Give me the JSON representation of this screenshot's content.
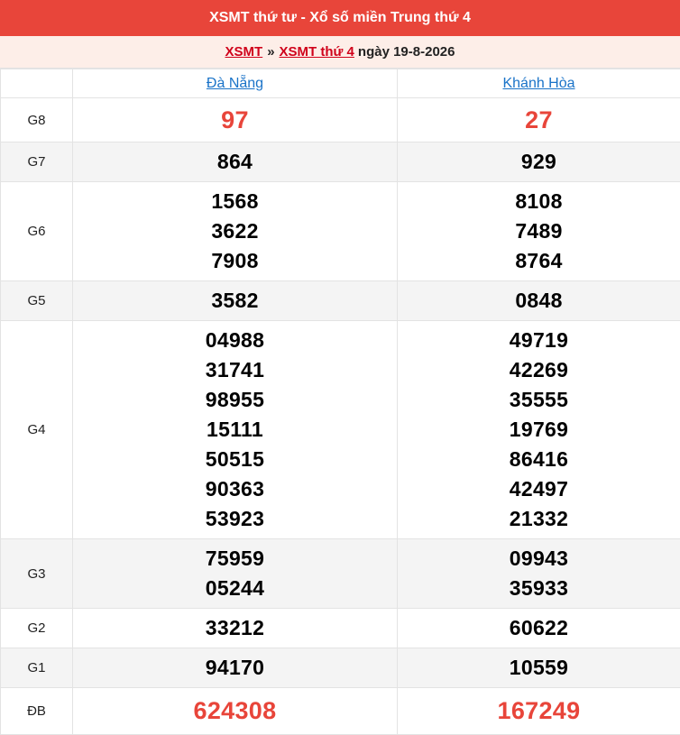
{
  "header": {
    "title": "XSMT thứ tư - Xổ số miền Trung thứ 4"
  },
  "breadcrumb": {
    "link1": "XSMT",
    "separator": "»",
    "link2": "XSMT thứ 4",
    "date": "ngày 19-8-2026"
  },
  "provinces": [
    "Đà Nẵng",
    "Khánh Hòa"
  ],
  "prizes": [
    {
      "label": "G8",
      "da_nang": [
        "97"
      ],
      "khanh_hoa": [
        "27"
      ]
    },
    {
      "label": "G7",
      "da_nang": [
        "864"
      ],
      "khanh_hoa": [
        "929"
      ]
    },
    {
      "label": "G6",
      "da_nang": [
        "1568",
        "3622",
        "7908"
      ],
      "khanh_hoa": [
        "8108",
        "7489",
        "8764"
      ]
    },
    {
      "label": "G5",
      "da_nang": [
        "3582"
      ],
      "khanh_hoa": [
        "0848"
      ]
    },
    {
      "label": "G4",
      "da_nang": [
        "04988",
        "31741",
        "98955",
        "15111",
        "50515",
        "90363",
        "53923"
      ],
      "khanh_hoa": [
        "49719",
        "42269",
        "35555",
        "19769",
        "86416",
        "42497",
        "21332"
      ]
    },
    {
      "label": "G3",
      "da_nang": [
        "75959",
        "05244"
      ],
      "khanh_hoa": [
        "09943",
        "35933"
      ]
    },
    {
      "label": "G2",
      "da_nang": [
        "33212"
      ],
      "khanh_hoa": [
        "60622"
      ]
    },
    {
      "label": "G1",
      "da_nang": [
        "94170"
      ],
      "khanh_hoa": [
        "10559"
      ]
    },
    {
      "label": "ĐB",
      "da_nang": [
        "624308"
      ],
      "khanh_hoa": [
        "167249"
      ]
    }
  ],
  "colors": {
    "accent": "#e8453a",
    "link": "#1a73c8",
    "breadcrumb_bg": "#fdeee8"
  }
}
